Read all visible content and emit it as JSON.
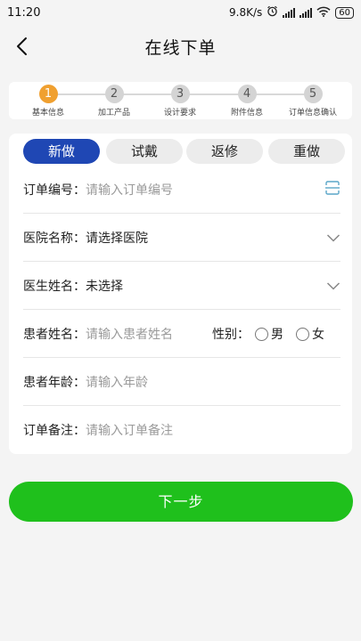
{
  "status": {
    "time": "11:20",
    "net_speed": "9.8K/s",
    "battery": "60"
  },
  "nav": {
    "title": "在线下单"
  },
  "steps": [
    {
      "num": "1",
      "label": "基本信息"
    },
    {
      "num": "2",
      "label": "加工产品"
    },
    {
      "num": "3",
      "label": "设计要求"
    },
    {
      "num": "4",
      "label": "附件信息"
    },
    {
      "num": "5",
      "label": "订单信息确认"
    }
  ],
  "order_types": [
    "新做",
    "试戴",
    "返修",
    "重做"
  ],
  "form": {
    "order_no": {
      "label": "订单编号：",
      "placeholder": "请输入订单编号"
    },
    "hospital": {
      "label": "医院名称：",
      "value": "请选择医院"
    },
    "doctor": {
      "label": "医生姓名：",
      "value": "未选择"
    },
    "patient": {
      "label": "患者姓名：",
      "placeholder": "请输入患者姓名"
    },
    "gender": {
      "label": "性别：",
      "options": [
        "男",
        "女"
      ]
    },
    "age": {
      "label": "患者年龄：",
      "placeholder": "请输入年龄"
    },
    "remark": {
      "label": "订单备注：",
      "placeholder": "请输入订单备注"
    }
  },
  "next_label": "下一步",
  "colors": {
    "primary": "#1f47b4",
    "step_active": "#f0a030",
    "next_button": "#1fc01c"
  }
}
